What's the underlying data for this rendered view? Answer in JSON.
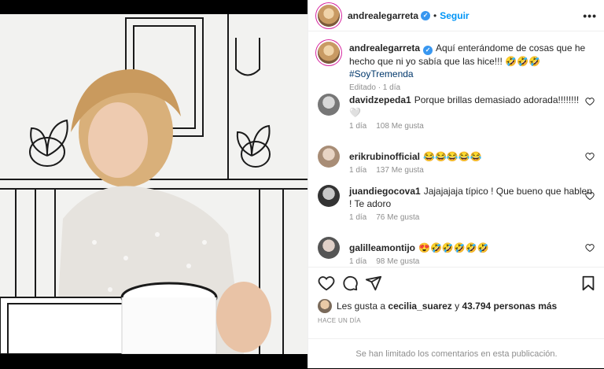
{
  "post": {
    "username": "andrealegarreta",
    "follow_label": "Seguir",
    "separator": "•",
    "more_label": "•••"
  },
  "caption": {
    "username": "andrealegarreta",
    "text": "Aquí enterándome de cosas que he hecho que ni yo sabía que las hice!!! 🤣🤣🤣",
    "hashtag": "#SoyTremenda",
    "meta": "Editado · 1 día"
  },
  "comments": [
    {
      "username": "davidzepeda1",
      "text": "Porque brillas demasiado adorada!!!!!!!! 🤍",
      "time": "1 día",
      "likes": "108 Me gusta"
    },
    {
      "username": "erikrubinofficial",
      "text": "😂😂😂😂😂",
      "time": "1 día",
      "likes": "137 Me gusta"
    },
    {
      "username": "juandiegocova1",
      "text": "Jajajajaja típico ! Que bueno que hablen ! Te adoro",
      "time": "1 día",
      "likes": "76 Me gusta"
    },
    {
      "username": "galilleamontijo",
      "text": "😍🤣🤣🤣🤣🤣",
      "time": "1 día",
      "likes": "98 Me gusta"
    }
  ],
  "likes": {
    "prefix": "Les gusta a",
    "user": "cecilia_suarez",
    "middle": "y",
    "count": "43.794 personas más"
  },
  "posted": "HACE UN DÍA",
  "limited_notice": "Se han limitado los comentarios en esta publicación.",
  "icons": [
    "heart-icon",
    "comment-icon",
    "share-icon",
    "bookmark-icon",
    "verified-icon",
    "more-icon"
  ],
  "colors": {
    "link": "#0095f6",
    "verified": "#3897f0",
    "muted": "#8e8e8e"
  }
}
